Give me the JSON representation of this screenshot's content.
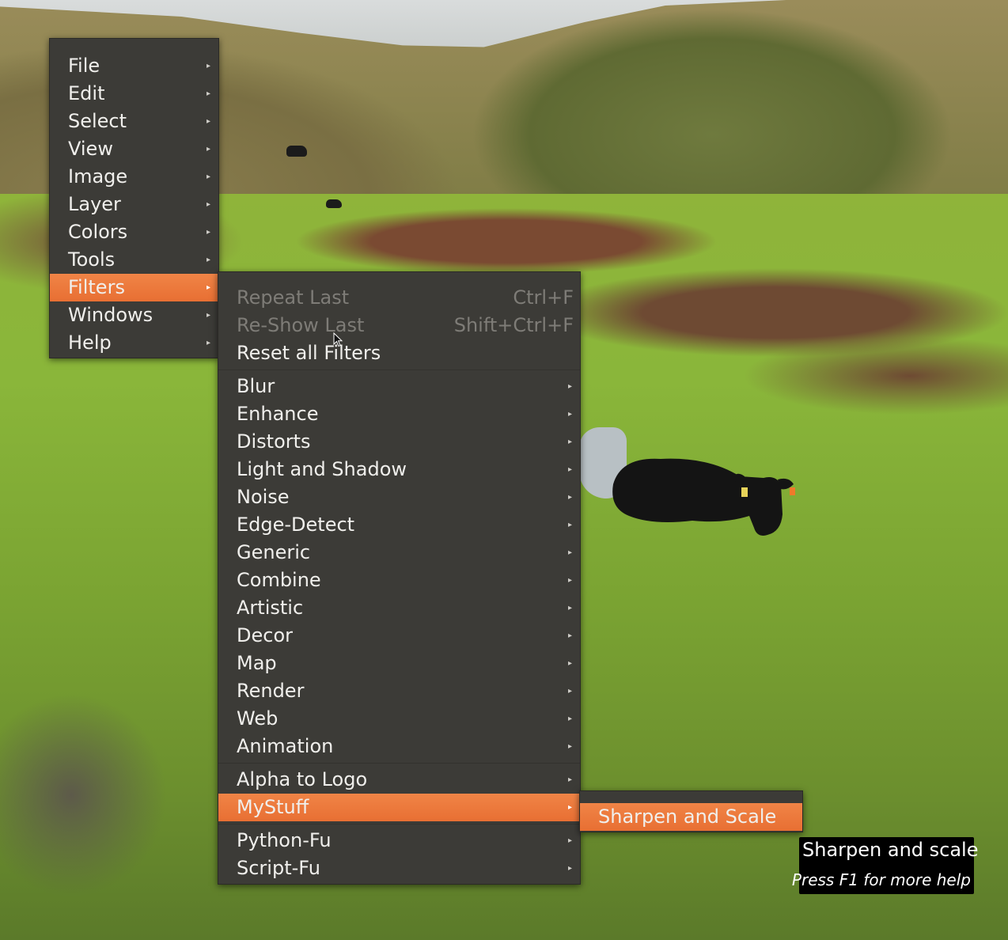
{
  "main_menu": {
    "items": [
      {
        "label": "File",
        "has_submenu": true
      },
      {
        "label": "Edit",
        "has_submenu": true
      },
      {
        "label": "Select",
        "has_submenu": true
      },
      {
        "label": "View",
        "has_submenu": true
      },
      {
        "label": "Image",
        "has_submenu": true
      },
      {
        "label": "Layer",
        "has_submenu": true
      },
      {
        "label": "Colors",
        "has_submenu": true
      },
      {
        "label": "Tools",
        "has_submenu": true
      },
      {
        "label": "Filters",
        "has_submenu": true,
        "active": true
      },
      {
        "label": "Windows",
        "has_submenu": true
      },
      {
        "label": "Help",
        "has_submenu": true
      }
    ]
  },
  "filters_menu": {
    "repeat_last": {
      "label": "Repeat Last",
      "shortcut": "Ctrl+F",
      "enabled": false
    },
    "reshow_last": {
      "label": "Re-Show Last",
      "shortcut": "Shift+Ctrl+F",
      "enabled": false
    },
    "reset_all": {
      "label": "Reset all Filters"
    },
    "categories": [
      "Blur",
      "Enhance",
      "Distorts",
      "Light and Shadow",
      "Noise",
      "Edge-Detect",
      "Generic",
      "Combine",
      "Artistic",
      "Decor",
      "Map",
      "Render",
      "Web",
      "Animation"
    ],
    "alpha_to_logo": "Alpha to Logo",
    "mystuff": "MyStuff",
    "python_fu": "Python-Fu",
    "script_fu": "Script-Fu"
  },
  "mystuff_menu": {
    "items": [
      {
        "label": "Sharpen and Scale",
        "active": true
      }
    ]
  },
  "tooltip": {
    "title": "Sharpen and scale",
    "hint": "Press F1 for more help"
  },
  "colors": {
    "menu_bg": "#3c3b37",
    "highlight": "#e97a3d",
    "text": "#f0efec",
    "disabled_text": "#7e7c77"
  },
  "icons": {
    "submenu_arrow": "small-triangle-right",
    "cursor": "arrow-pointer"
  }
}
